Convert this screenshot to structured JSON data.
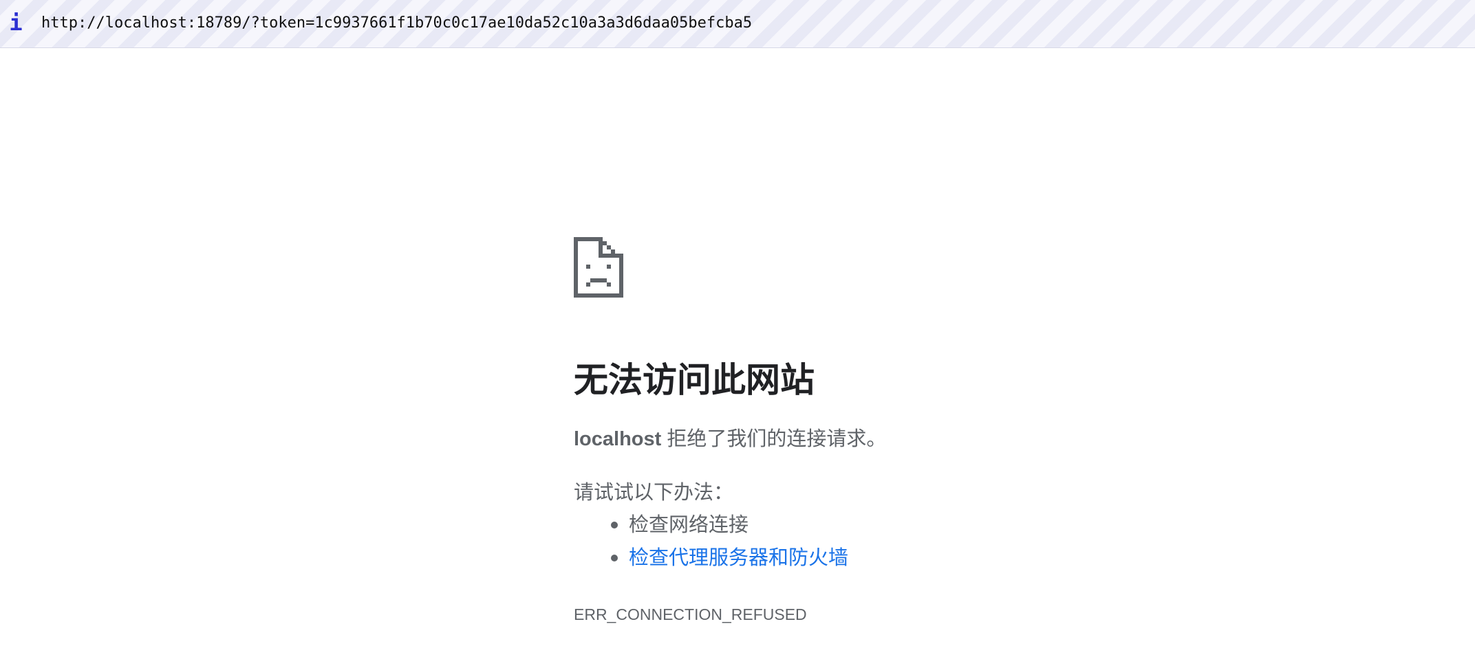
{
  "url_bar": {
    "icon": "info-icon",
    "icon_glyph": "i",
    "url": "http://localhost:18789/?token=1c9937661f1b70c0c17ae10da52c10a3a3d6daa05befcba5"
  },
  "error_page": {
    "icon": "sad-document-icon",
    "heading": "无法访问此网站",
    "host": "localhost",
    "summary_rest": " 拒绝了我们的连接请求。",
    "suggestions_title": "请试试以下办法：",
    "suggestions": [
      {
        "label": "检查网络连接",
        "link": false
      },
      {
        "label": "检查代理服务器和防火墙",
        "link": true
      }
    ],
    "error_code": "ERR_CONNECTION_REFUSED"
  },
  "colors": {
    "heading": "#202124",
    "body_text": "#5f6368",
    "link": "#1a73e8",
    "info_icon": "#2b2fd1"
  }
}
